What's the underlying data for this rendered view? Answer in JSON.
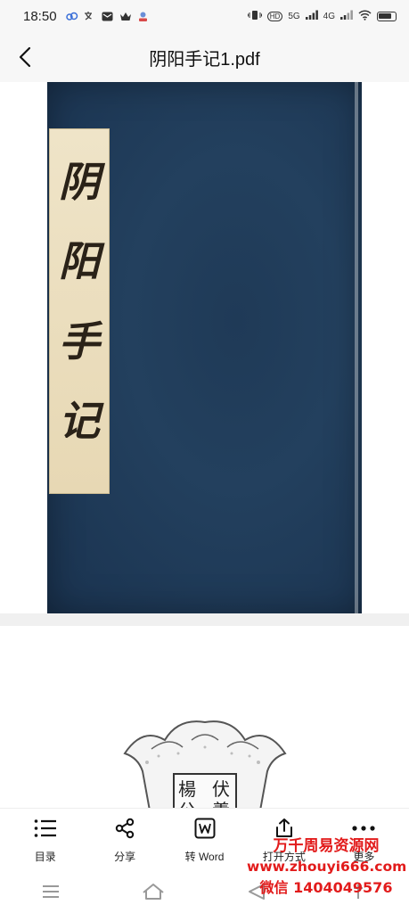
{
  "status_bar": {
    "time": "18:50",
    "left_icons": [
      "cloud-icon",
      "translate-icon",
      "mail-icon",
      "crown-icon",
      "app-icon"
    ],
    "network_5g": "5G",
    "network_4g": "4G",
    "hd_badge": "HD"
  },
  "header": {
    "title": "阴阳手记1.pdf"
  },
  "document": {
    "cover_title_chars": [
      "阴",
      "阳",
      "手",
      "记"
    ],
    "second_page_seal_chars": [
      "伏",
      "羲",
      "楊",
      "公"
    ]
  },
  "toolbar": {
    "items": [
      {
        "label": "目录",
        "icon": "toc-icon"
      },
      {
        "label": "分享",
        "icon": "share-icon"
      },
      {
        "label": "转 Word",
        "icon": "word-icon"
      },
      {
        "label": "打开方式",
        "icon": "open-with-icon"
      },
      {
        "label": "更多",
        "icon": "more-icon"
      }
    ]
  },
  "watermark": {
    "line1": "万千周易资源网",
    "line2": "www.zhouyi666.com",
    "line3": "微信 1404049576"
  },
  "colors": {
    "cover_blue": "#1f3a57",
    "slip_paper": "#e9dcbb",
    "watermark_red": "#e21b1b"
  }
}
